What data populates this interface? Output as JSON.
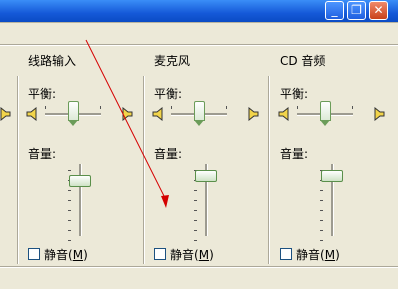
{
  "window": {
    "minimize_glyph": "_",
    "restore_glyph": "❐",
    "close_glyph": "✕"
  },
  "columns": [
    {
      "title": "线路输入",
      "balance_label": "平衡:",
      "volume_label": "音量:",
      "mute_label": "静音",
      "mute_key": "M",
      "mute_checked": false,
      "balance_value": 0.5,
      "volume_value": 0.82
    },
    {
      "title": "麦克风",
      "balance_label": "平衡:",
      "volume_label": "音量:",
      "mute_label": "静音",
      "mute_key": "M",
      "mute_checked": false,
      "balance_value": 0.5,
      "volume_value": 0.9
    },
    {
      "title": "CD 音频",
      "balance_label": "平衡:",
      "volume_label": "音量:",
      "mute_label": "静音",
      "mute_key": "M",
      "mute_checked": false,
      "balance_value": 0.5,
      "volume_value": 0.9
    }
  ],
  "colors": {
    "background": "#ece9d8",
    "titlebar": "#1559d8",
    "arrow": "#d40000",
    "thumb_border": "#5a8f4a"
  },
  "icons": {
    "speaker_left": "speaker-left-icon",
    "speaker_right": "speaker-right-icon"
  }
}
